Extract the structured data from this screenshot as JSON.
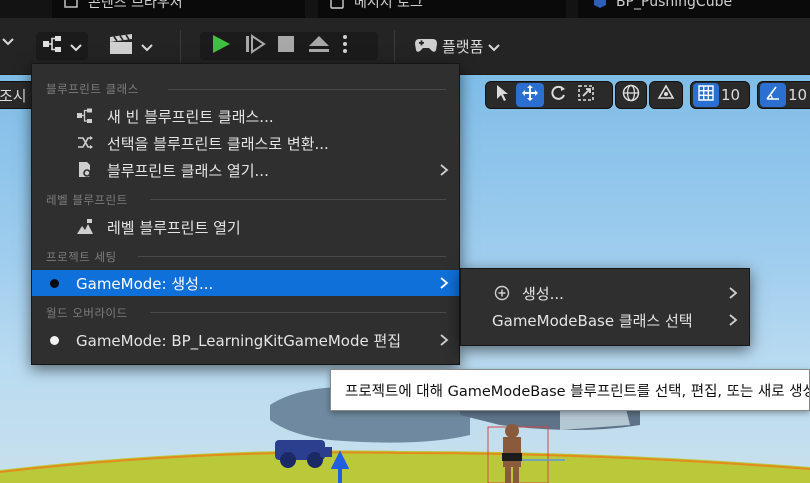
{
  "tabs": [
    {
      "label": "콘텐츠 브라우저",
      "icon": "folder-icon"
    },
    {
      "label": "메시지 로그",
      "icon": "message-log-icon"
    },
    {
      "label": "BP_PushingCube",
      "icon": "blueprint-icon"
    }
  ],
  "toolbar": {
    "platforms_label": "플랫폼"
  },
  "viewport": {
    "left_label": "조시",
    "grid_value": "10",
    "angle_value": "10"
  },
  "blueprint_menu": {
    "section_blueprint_class": "블루프린트 클래스",
    "new_blueprint_class": "새 빈 블루프린트 클래스...",
    "convert_selection": "선택을 블루프린트 클래스로 변환...",
    "open_blueprint_class": "블루프린트 클래스 열기...",
    "section_level_blueprint": "레벨 블루프린트",
    "open_level_blueprint": "레벨 블루프린트 열기",
    "section_project_settings": "프로젝트 세팅",
    "gamemode_create": "GameMode: 생성...",
    "section_world_override": "월드 오버라이드",
    "gamemode_edit": "GameMode: BP_LearningKitGameMode 편집"
  },
  "submenu": {
    "create": "생성...",
    "select_base_class": "GameModeBase 클래스 선택"
  },
  "tooltip": {
    "text": "프로젝트에 대해 GameModeBase 블루프린트를 선택, 편집, 또는 새로 생성"
  },
  "colors": {
    "accent": "#0f70d9",
    "play_green": "#3fbf3f"
  }
}
